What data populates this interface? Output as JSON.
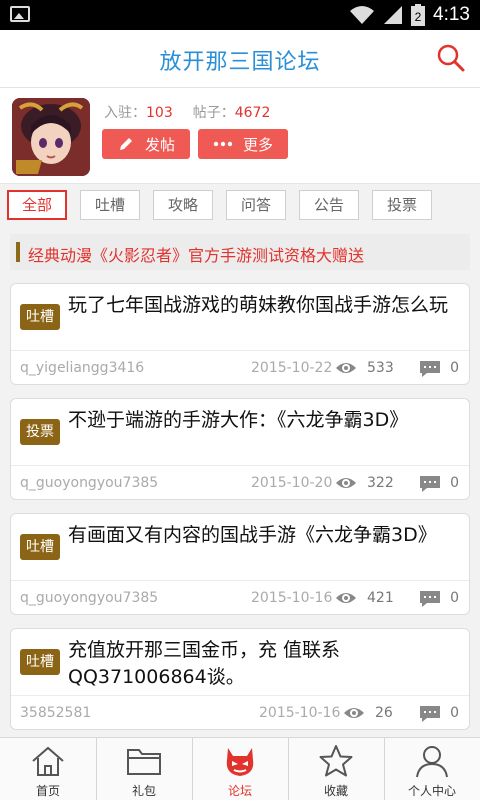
{
  "status_bar": {
    "time": "4:13",
    "battery_level": "2"
  },
  "header": {
    "title": "放开那三国论坛"
  },
  "forum": {
    "residents_label": "入驻：",
    "residents_value": "103",
    "posts_label": "帖子：",
    "posts_value": "4672",
    "post_button": "发帖",
    "more_button": "更多"
  },
  "tabs": [
    "全部",
    "吐槽",
    "攻略",
    "问答",
    "公告",
    "投票"
  ],
  "active_tab": "全部",
  "announcement": "经典动漫《火影忍者》官方手游测试资格大赠送",
  "posts": [
    {
      "tag": "吐槽",
      "title": "玩了七年国战游戏的萌妹教你国战手游怎么玩",
      "author": "q_yigeliangg3416",
      "date": "2015-10-22",
      "views": "533",
      "comments": "0"
    },
    {
      "tag": "投票",
      "title": "不逊于端游的手游大作：《六龙争霸3D》",
      "author": "q_guoyongyou7385",
      "date": "2015-10-20",
      "views": "322",
      "comments": "0"
    },
    {
      "tag": "吐槽",
      "title": "有画面又有内容的国战手游《六龙争霸3D》",
      "author": "q_guoyongyou7385",
      "date": "2015-10-16",
      "views": "421",
      "comments": "0"
    },
    {
      "tag": "吐槽",
      "title": "充值放开那三国金币，充 值联系QQ371006864谈。",
      "author": "35852581",
      "date": "2015-10-16",
      "views": "26",
      "comments": "0"
    }
  ],
  "bottom_nav": [
    {
      "label": "首页",
      "icon": "home-icon"
    },
    {
      "label": "礼包",
      "icon": "folder-icon"
    },
    {
      "label": "论坛",
      "icon": "devil-icon"
    },
    {
      "label": "收藏",
      "icon": "star-icon"
    },
    {
      "label": "个人中心",
      "icon": "person-icon"
    }
  ],
  "active_nav": "论坛",
  "colors": {
    "accent": "#e2322d",
    "title_blue": "#2b8fd6",
    "tag_brown": "#8b6415",
    "button_red": "#ef5a55"
  }
}
